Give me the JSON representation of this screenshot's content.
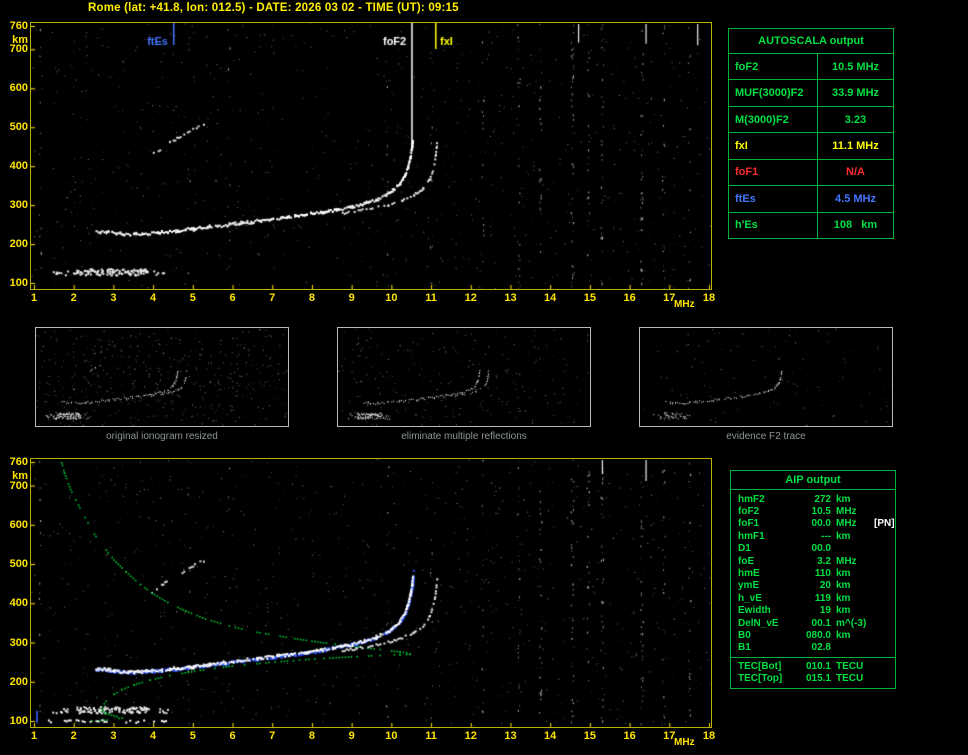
{
  "header": {
    "title": "Rome (lat: +41.8, lon: 012.5) - DATE: 2026 03 02 - TIME (UT): 09:15"
  },
  "colors": {
    "axis": "#ffe400",
    "panel_border": "#b9b000",
    "trace_white": "#ffffff",
    "table_green": "#00e040",
    "table_border_green": "#00b435",
    "value_yellow": "#ffff00",
    "value_red": "#ff2a2a",
    "value_blue": "#4477ff",
    "profile_green": "#00c832",
    "overlay_blue": "#2f55ee"
  },
  "autoscala": {
    "title": "AUTOSCALA output",
    "rows": [
      {
        "label": "foF2",
        "value": "10.5 MHz",
        "color": "#00e040"
      },
      {
        "label": "MUF(3000)F2",
        "value": "33.9 MHz",
        "color": "#00e040"
      },
      {
        "label": "M(3000)F2",
        "value": "3.23",
        "color": "#00e040"
      },
      {
        "label": "fxI",
        "value": "11.1 MHz",
        "color": "#ffff00"
      },
      {
        "label": "foF1",
        "value": "N/A",
        "color": "#ff2a2a"
      },
      {
        "label": "ftEs",
        "value": "4.5 MHz",
        "color": "#4477ff"
      },
      {
        "label": "h'Es",
        "value": "108   km",
        "color": "#00e040"
      }
    ]
  },
  "thumbnails": [
    {
      "caption": "original ionogram resized"
    },
    {
      "caption": "eliminate multiple reflections"
    },
    {
      "caption": "evidence F2 trace"
    }
  ],
  "aip": {
    "title": "AIP output",
    "rows": [
      {
        "label": "hmF2",
        "value": "272",
        "unit": "km",
        "extra": ""
      },
      {
        "label": "foF2",
        "value": "10.5",
        "unit": "MHz",
        "extra": ""
      },
      {
        "label": "foF1",
        "value": "00.0",
        "unit": "MHz",
        "extra": "[PN]"
      },
      {
        "label": "hmF1",
        "value": "---",
        "unit": "km",
        "extra": ""
      },
      {
        "label": "D1",
        "value": "00.0",
        "unit": "",
        "extra": ""
      },
      {
        "label": "foE",
        "value": "3.2",
        "unit": "MHz",
        "extra": ""
      },
      {
        "label": "hmE",
        "value": "110",
        "unit": "km",
        "extra": ""
      },
      {
        "label": "ymE",
        "value": "20",
        "unit": "km",
        "extra": ""
      },
      {
        "label": "h_vE",
        "value": "119",
        "unit": "km",
        "extra": ""
      },
      {
        "label": "Ewidth",
        "value": "19",
        "unit": "km",
        "extra": ""
      },
      {
        "label": "DelN_vE",
        "value": "00.1",
        "unit": "m^(-3)",
        "extra": ""
      },
      {
        "label": "B0",
        "value": "080.0",
        "unit": "km",
        "extra": ""
      },
      {
        "label": "B1",
        "value": "02.8",
        "unit": "",
        "extra": ""
      }
    ],
    "tec_rows": [
      {
        "label": "TEC[Bot]",
        "value": "010.1",
        "unit": "TECU"
      },
      {
        "label": "TEC[Top]",
        "value": "015.1",
        "unit": "TECU"
      }
    ]
  },
  "chart_data": [
    {
      "type": "scatter",
      "name": "ionogram-autoscaled",
      "title": "Ionogram with AUTOSCALA markers",
      "xlabel": "MHz",
      "ylabel": "km",
      "xlim": [
        1,
        18
      ],
      "ylim": [
        100,
        760
      ],
      "x_ticks": [
        1,
        2,
        3,
        4,
        5,
        6,
        7,
        8,
        9,
        10,
        11,
        12,
        13,
        14,
        15,
        16,
        17,
        18
      ],
      "y_ticks": [
        760,
        700,
        600,
        500,
        400,
        300,
        200,
        100
      ],
      "x_unit": "MHz",
      "y_unit": "km",
      "markers": [
        {
          "label": "ftEs",
          "freq": 4.5,
          "color": "#4477ff",
          "side": "left",
          "len": 22
        },
        {
          "label": "foF2",
          "freq": 10.5,
          "color": "#ffffff",
          "side": "left",
          "len": 124
        },
        {
          "label": "fxI",
          "freq": 11.1,
          "color": "#ffff00",
          "side": "right",
          "len": 26
        }
      ],
      "series": [
        {
          "name": "F2-O-trace",
          "points": [
            [
              2.55,
              234
            ],
            [
              2.85,
              233
            ],
            [
              3.0,
              230
            ],
            [
              3.2,
              228
            ],
            [
              3.5,
              228
            ],
            [
              3.8,
              229
            ],
            [
              4.2,
              232
            ],
            [
              4.6,
              236
            ],
            [
              5.0,
              241
            ],
            [
              5.4,
              246
            ],
            [
              5.8,
              251
            ],
            [
              6.2,
              256
            ],
            [
              6.6,
              261
            ],
            [
              7.0,
              266
            ],
            [
              7.4,
              271
            ],
            [
              7.8,
              277
            ],
            [
              8.2,
              283
            ],
            [
              8.6,
              290
            ],
            [
              9.0,
              298
            ],
            [
              9.3,
              306
            ],
            [
              9.6,
              316
            ],
            [
              9.85,
              328
            ],
            [
              10.05,
              342
            ],
            [
              10.2,
              358
            ],
            [
              10.32,
              378
            ],
            [
              10.4,
              400
            ],
            [
              10.46,
              425
            ],
            [
              10.5,
              450
            ],
            [
              10.52,
              468
            ]
          ]
        },
        {
          "name": "F2-X-trace",
          "points": [
            [
              8.7,
              280
            ],
            [
              9.1,
              287
            ],
            [
              9.5,
              294
            ],
            [
              9.9,
              303
            ],
            [
              10.25,
              314
            ],
            [
              10.55,
              328
            ],
            [
              10.78,
              345
            ],
            [
              10.93,
              366
            ],
            [
              11.02,
              390
            ],
            [
              11.08,
              418
            ],
            [
              11.11,
              445
            ],
            [
              11.13,
              464
            ]
          ]
        },
        {
          "name": "Es-layer",
          "band": {
            "f1": 1.45,
            "f2": 4.35,
            "h": 128,
            "d1": 2.05,
            "d2": 3.85,
            "p": 0.85
          }
        },
        {
          "name": "multiple-reflection",
          "points": [
            [
              3.95,
              432
            ],
            [
              4.4,
              462
            ],
            [
              4.85,
              490
            ],
            [
              5.3,
              514
            ]
          ]
        }
      ]
    },
    {
      "type": "scatter",
      "name": "ionogram-with-profile",
      "title": "Ionogram with restored trace and electron density profile",
      "xlabel": "MHz",
      "ylabel": "km",
      "xlim": [
        1,
        18
      ],
      "ylim": [
        100,
        760
      ],
      "x_ticks": [
        1,
        2,
        3,
        4,
        5,
        6,
        7,
        8,
        9,
        10,
        11,
        12,
        13,
        14,
        15,
        16,
        17,
        18
      ],
      "y_ticks": [
        760,
        700,
        600,
        500,
        400,
        300,
        200,
        100
      ],
      "x_unit": "MHz",
      "y_unit": "km",
      "series": [
        {
          "name": "electron-density-profile",
          "color": "#00c832",
          "points": [
            [
              2.3,
              100
            ],
            [
              2.9,
              105
            ],
            [
              3.2,
              110
            ],
            [
              3.0,
              115
            ],
            [
              2.8,
              121
            ],
            [
              2.7,
              128
            ],
            [
              2.7,
              136
            ],
            [
              2.75,
              146
            ],
            [
              2.85,
              158
            ],
            [
              3.0,
              170
            ],
            [
              3.2,
              182
            ],
            [
              3.5,
              194
            ],
            [
              3.9,
              206
            ],
            [
              4.4,
              218
            ],
            [
              5.1,
              230
            ],
            [
              5.9,
              241
            ],
            [
              6.9,
              251
            ],
            [
              7.9,
              259
            ],
            [
              8.9,
              265
            ],
            [
              9.7,
              269
            ],
            [
              10.2,
              271
            ],
            [
              10.45,
              272
            ],
            [
              10.45,
              274
            ],
            [
              10.2,
              278
            ],
            [
              9.7,
              284
            ],
            [
              9.0,
              292
            ],
            [
              8.2,
              302
            ],
            [
              7.4,
              314
            ],
            [
              6.6,
              328
            ],
            [
              5.9,
              344
            ],
            [
              5.3,
              362
            ],
            [
              4.8,
              382
            ],
            [
              4.35,
              404
            ],
            [
              3.95,
              428
            ],
            [
              3.6,
              454
            ],
            [
              3.3,
              482
            ],
            [
              3.0,
              512
            ],
            [
              2.75,
              544
            ],
            [
              2.5,
              578
            ],
            [
              2.3,
              614
            ],
            [
              2.1,
              652
            ],
            [
              1.9,
              692
            ],
            [
              1.75,
              734
            ],
            [
              1.68,
              760
            ]
          ]
        },
        {
          "name": "restored-trace-overlay",
          "color": "#2f55ee",
          "note": "blue identified trace under white trace, same points as F2-O-trace"
        }
      ]
    }
  ]
}
